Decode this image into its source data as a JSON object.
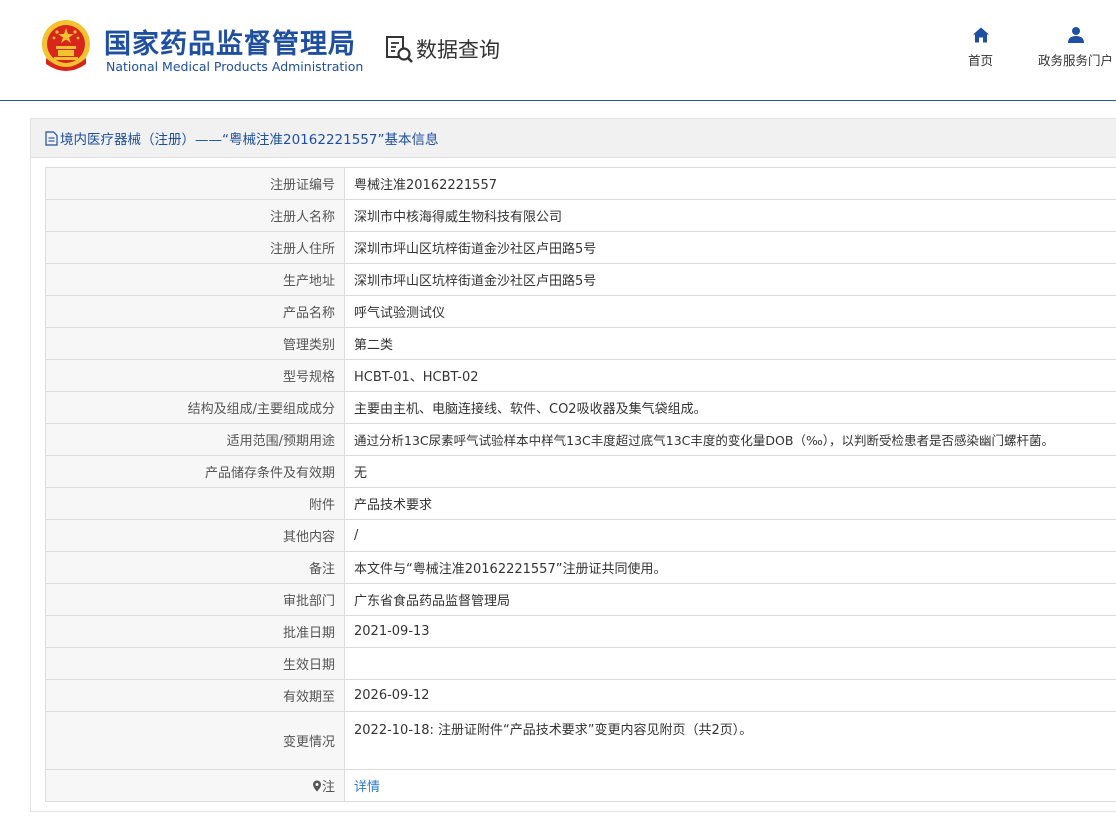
{
  "header": {
    "agency_cn": "国家药品监督管理局",
    "agency_en": "National Medical Products Administration",
    "page_title": "数据查询",
    "nav": [
      {
        "label": "首页",
        "icon": "home-icon"
      },
      {
        "label": "政务服务门户",
        "icon": "user-icon"
      }
    ]
  },
  "panel": {
    "title": "境内医疗器械（注册）——“粤械注准20162221557”基本信息",
    "icon": "document-icon"
  },
  "table": {
    "rows": [
      {
        "label": "注册证编号",
        "value": "粤械注准20162221557"
      },
      {
        "label": "注册人名称",
        "value": "深圳市中核海得威生物科技有限公司"
      },
      {
        "label": "注册人住所",
        "value": "深圳市坪山区坑梓街道金沙社区卢田路5号"
      },
      {
        "label": "生产地址",
        "value": "深圳市坪山区坑梓街道金沙社区卢田路5号"
      },
      {
        "label": "产品名称",
        "value": "呼气试验测试仪"
      },
      {
        "label": "管理类别",
        "value": "第二类"
      },
      {
        "label": "型号规格",
        "value": "HCBT-01、HCBT-02"
      },
      {
        "label": "结构及组成/主要组成成分",
        "value": "主要由主机、电脑连接线、软件、CO2吸收器及集气袋组成。"
      },
      {
        "label": "适用范围/预期用途",
        "value": "通过分析13C尿素呼气试验样本中样气13C丰度超过底气13C丰度的变化量DOB（‰），以判断受检患者是否感染幽门螺杆菌。"
      },
      {
        "label": "产品储存条件及有效期",
        "value": "无"
      },
      {
        "label": "附件",
        "value": "产品技术要求"
      },
      {
        "label": "其他内容",
        "value": "/"
      },
      {
        "label": "备注",
        "value": "本文件与“粤械注准20162221557”注册证共同使用。"
      },
      {
        "label": "审批部门",
        "value": "广东省食品药品监督管理局"
      },
      {
        "label": "批准日期",
        "value": "2021-09-13"
      },
      {
        "label": "生效日期",
        "value": ""
      },
      {
        "label": "有效期至",
        "value": "2026-09-12"
      },
      {
        "label": "变更情况",
        "value": "2022-10-18: 注册证附件“产品技术要求”变更内容见附页（共2页）。"
      }
    ],
    "note": {
      "label": "注",
      "icon": "pin-icon",
      "link": "详情"
    }
  },
  "colors": {
    "brand_blue": "#1e4fa0",
    "link_blue": "#2a7ac8",
    "emblem_red": "#d8261c",
    "emblem_gold": "#f2c230"
  }
}
